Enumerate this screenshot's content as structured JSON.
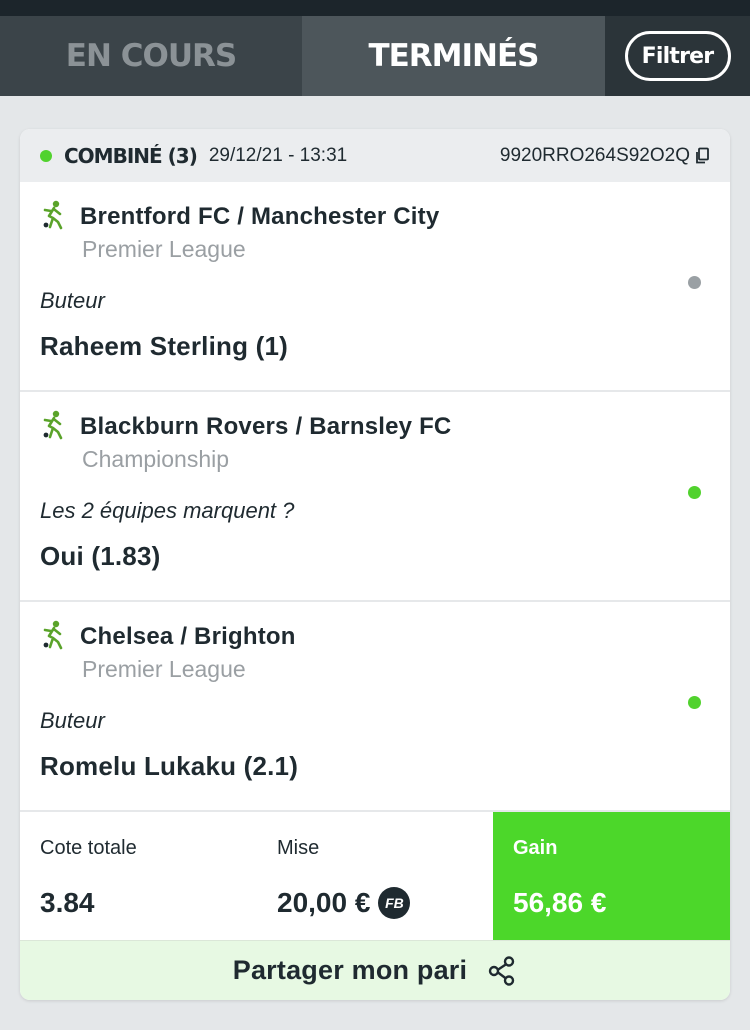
{
  "tabs": {
    "in_progress": "EN COURS",
    "finished": "TERMINÉS",
    "filter": "Filtrer"
  },
  "bet": {
    "type": "COMBINÉ (3)",
    "date": "29/12/21 - 13:31",
    "reference": "9920RRO264S92O2Q",
    "status_color": "#51d22e",
    "selections": [
      {
        "match": "Brentford FC / Manchester City",
        "league": "Premier League",
        "market": "Buteur",
        "pick": "Raheem Sterling (1)",
        "result_color": "#9aa0a4",
        "icon": "football-player-icon"
      },
      {
        "match": "Blackburn Rovers / Barnsley FC",
        "league": "Championship",
        "market": "Les 2 équipes marquent ?",
        "pick": "Oui (1.83)",
        "result_color": "#51d22e",
        "icon": "football-player-icon"
      },
      {
        "match": "Chelsea / Brighton",
        "league": "Premier League",
        "market": "Buteur",
        "pick": "Romelu Lukaku (2.1)",
        "result_color": "#51d22e",
        "icon": "football-player-icon"
      }
    ],
    "summary": {
      "odds_label": "Cote totale",
      "odds_value": "3.84",
      "stake_label": "Mise",
      "stake_value": "20,00 €",
      "freebet_badge": "FB",
      "gain_label": "Gain",
      "gain_value": "56,86 €",
      "gain_color": "#4cd72a"
    },
    "share_label": "Partager mon pari"
  }
}
